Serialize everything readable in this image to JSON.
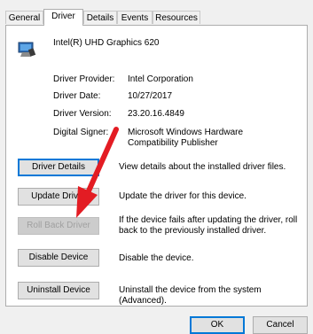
{
  "tabs": [
    {
      "label": "General"
    },
    {
      "label": "Driver"
    },
    {
      "label": "Details"
    },
    {
      "label": "Events"
    },
    {
      "label": "Resources"
    }
  ],
  "device_name": "Intel(R) UHD Graphics 620",
  "info": {
    "provider_label": "Driver Provider:",
    "provider_value": "Intel Corporation",
    "date_label": "Driver Date:",
    "date_value": "10/27/2017",
    "version_label": "Driver Version:",
    "version_value": "23.20.16.4849",
    "signer_label": "Digital Signer:",
    "signer_value": "Microsoft Windows Hardware Compatibility Publisher"
  },
  "actions": [
    {
      "label": "Driver Details",
      "desc": "View details about the installed driver files."
    },
    {
      "label": "Update Driver",
      "desc": "Update the driver for this device."
    },
    {
      "label": "Roll Back Driver",
      "desc": "If the device fails after updating the driver, roll back to the previously installed driver."
    },
    {
      "label": "Disable Device",
      "desc": "Disable the device."
    },
    {
      "label": "Uninstall Device",
      "desc": "Uninstall the device from the system (Advanced)."
    }
  ],
  "footer": {
    "ok": "OK",
    "cancel": "Cancel"
  },
  "colors": {
    "arrow": "#e31c23",
    "focus": "#0078d7"
  }
}
